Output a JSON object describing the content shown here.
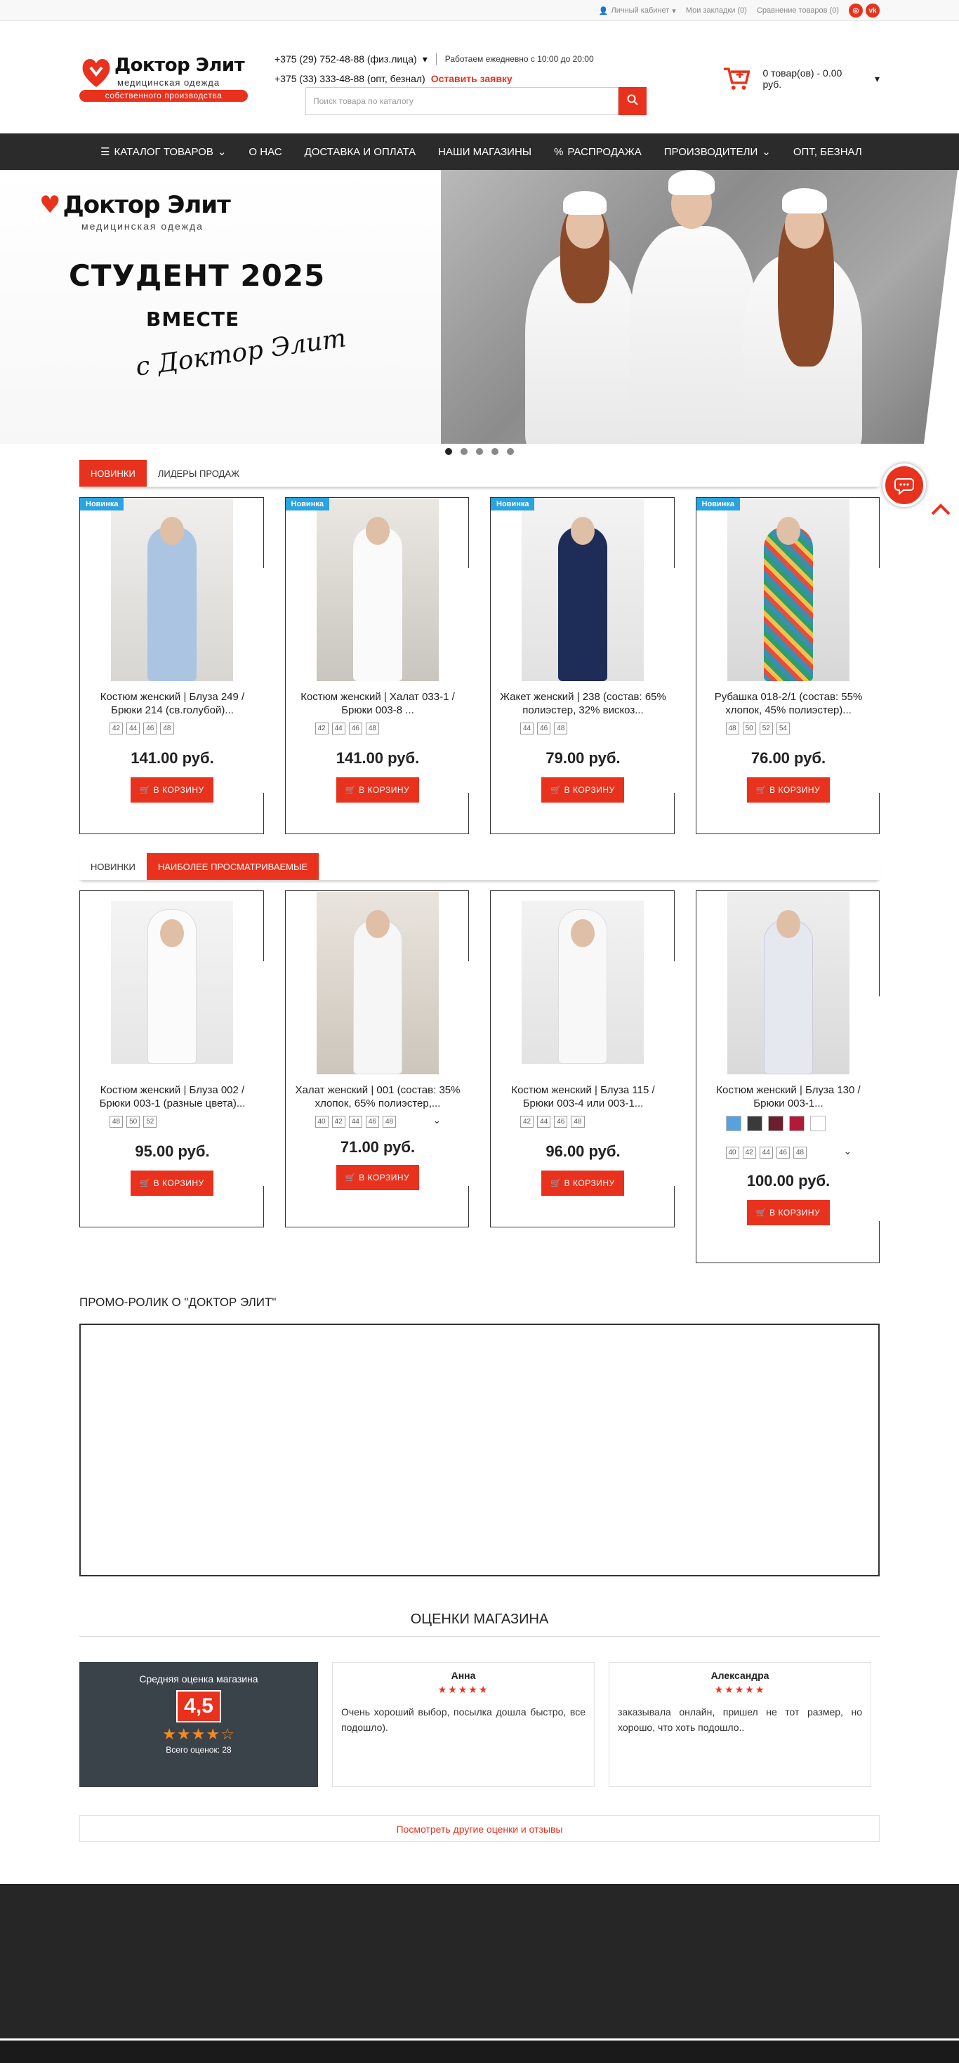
{
  "topbar": {
    "account": "Личный кабинет",
    "bookmarks": "Мои закладки (0)",
    "compare": "Сравнение товаров (0)",
    "social": [
      "instagram-icon",
      "vk-icon"
    ],
    "social_labels": [
      "◎",
      "vk"
    ]
  },
  "header": {
    "logo_brand": "Доктор Элит",
    "logo_sub": "медицинская одежда",
    "logo_strip": "собственного производства",
    "phone1": "+375 (29) 752-48-88 (физ.лица)",
    "hours": "Работаем ежедневно с 10:00 до 20:00",
    "phone2": "+375 (33) 333-48-88 (опт, безнал)",
    "order_link": "Оставить заявку",
    "search_placeholder": "Поиск товара по каталогу",
    "cart": "0 товар(ов) - 0.00 руб."
  },
  "nav": {
    "items": [
      {
        "label": "Каталог товаров",
        "icon": "menu-icon",
        "dropdown": true
      },
      {
        "label": "О нас"
      },
      {
        "label": "Доставка и оплата"
      },
      {
        "label": "Наши магазины"
      },
      {
        "label": "Распродажа",
        "icon": "percent-icon"
      },
      {
        "label": "Производители",
        "dropdown": true
      },
      {
        "label": "Опт, безнал"
      }
    ]
  },
  "banner": {
    "brand": "Доктор Элит",
    "brand_sub": "медицинская одежда",
    "title": "СТУДЕНТ 2025",
    "title2": "ВМЕСТЕ",
    "script": "с Доктор Элит",
    "slides": 5,
    "active_slide": 1
  },
  "block1": {
    "tabs": [
      "Новинки",
      "Лидеры продаж"
    ],
    "active_tab": 0,
    "badge": "Новинка",
    "products": [
      {
        "name": "Костюм женский | Блуза 249 / Брюки 214 (св.голубой)...",
        "sizes": [
          "42",
          "44",
          "46",
          "48"
        ],
        "price": "141.00 руб.",
        "color": "#aac4e2"
      },
      {
        "name": "Костюм женский | Халат 033-1 / Брюки 003-8 ...",
        "sizes": [
          "42",
          "44",
          "46",
          "48"
        ],
        "price": "141.00 руб.",
        "color": "#f4f4f4"
      },
      {
        "name": "Жакет женский | 238 (состав: 65% полиэстер, 32% вискоз...",
        "sizes": [
          "44",
          "46",
          "48"
        ],
        "price": "79.00 руб.",
        "color": "#1e2c58"
      },
      {
        "name": "Рубашка 018-2/1 (состав: 55% хлопок, 45% полиэстер)...",
        "sizes": [
          "48",
          "50",
          "52",
          "54"
        ],
        "price": "76.00 руб.",
        "color": "#3a8fb0"
      }
    ]
  },
  "block2": {
    "tabs": [
      "Новинки",
      "Наиболее просматриваемые"
    ],
    "active_tab": 1,
    "products": [
      {
        "name": "Костюм женский | Блуза 002 / Брюки 003-1 (разные цвета)...",
        "sizes": [
          "48",
          "50",
          "52"
        ],
        "price": "95.00 руб.",
        "color": "#f2f2f2"
      },
      {
        "name": "Халат женский | 001 (состав: 35% хлопок, 65% полиэстер,...",
        "sizes": [
          "40",
          "42",
          "44",
          "46",
          "48"
        ],
        "price": "71.00 руб.",
        "color": "#f5f5f5",
        "more": true
      },
      {
        "name": "Костюм женский | Блуза 115 / Брюки 003-4 или 003-1...",
        "sizes": [
          "42",
          "44",
          "46",
          "48"
        ],
        "price": "96.00 руб.",
        "color": "#f3f3f3"
      },
      {
        "name": "Костюм женский | Блуза 130 / Брюки 003-1...",
        "sizes": [
          "40",
          "42",
          "44",
          "46",
          "48"
        ],
        "price": "100.00 руб.",
        "color": "#e6e8f0",
        "more": true,
        "swatches": [
          "#5aa0dc",
          "#3a3a3a",
          "#6b1e2e",
          "#b01c38",
          "#ffffff"
        ]
      }
    ]
  },
  "buy_label": "В КОРЗИНУ",
  "promo": {
    "title": "ПРОМО-РОЛИК О \"ДОКТОР ЭЛИТ\""
  },
  "reviews": {
    "title": "ОЦЕНКИ МАГАЗИНА",
    "avg_label": "Средняя оценка магазина",
    "score": "4,5",
    "total": "Всего оценок: 28",
    "items": [
      {
        "author": "Анна",
        "text": "Очень хороший выбор, посылка дошла быстро, все подошло)."
      },
      {
        "author": "Александра",
        "text": "заказывала онлайн, пришел не тот размер, но хорошо, что хоть подошло.."
      }
    ],
    "more": "Посмотреть другие оценки и отзывы"
  },
  "colors": {
    "accent": "#e8321d",
    "nav": "#2b2b2b",
    "badge": "#2aa3e0",
    "footer": "#262626"
  }
}
